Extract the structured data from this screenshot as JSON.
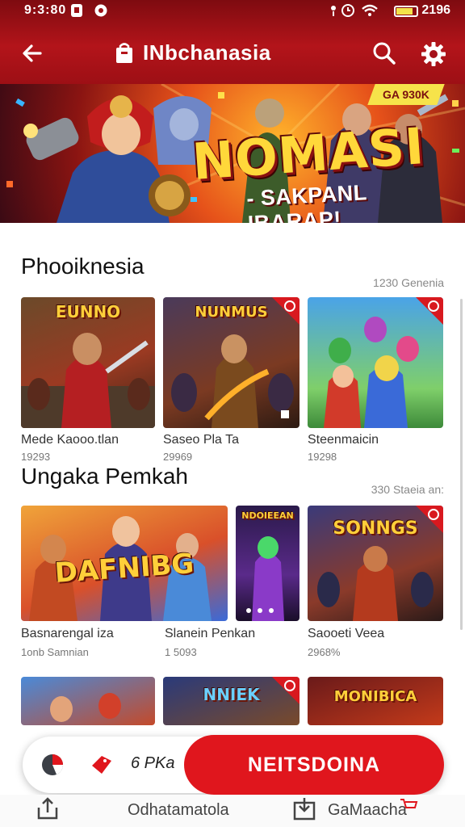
{
  "status_bar": {
    "time": "9:3:80",
    "battery_text": "2196"
  },
  "header": {
    "app_title": "INbchanasia"
  },
  "banner": {
    "corner_text": "GA 930K",
    "title": "NOMASI",
    "subtitle": "- SAKPANL IBARAP!"
  },
  "sections": [
    {
      "title": "Phooiknesia",
      "meta": "1230 Genenia",
      "cards": [
        {
          "thumb_text": "EUNNO",
          "title": "Mede Kaooo.tlan",
          "sub": "19293"
        },
        {
          "thumb_text": "NUNMUS",
          "title": "Saseo Pla Ta",
          "sub": "29969"
        },
        {
          "thumb_text": "",
          "title": "Steenmaicin",
          "sub": "19298"
        }
      ]
    },
    {
      "title": "Ungaka Pemkah",
      "meta": "330 Staeia an:",
      "cards": [
        {
          "thumb_text": "DAFNIBG",
          "title": "Basnarengal iza",
          "sub": "1onb Samnian"
        },
        {
          "thumb_text": "NDOIEEAN",
          "title": "Slanein Penkan",
          "sub": "1 5093"
        },
        {
          "thumb_text": "SONNGS",
          "title": "Saooeti Veea",
          "sub": "2968%"
        }
      ]
    },
    {
      "title": "",
      "meta": "",
      "cards": [
        {
          "thumb_text": "",
          "title": "",
          "sub": ""
        },
        {
          "thumb_text": "NNIEK",
          "title": "",
          "sub": ""
        },
        {
          "thumb_text": "MONIBICA",
          "title": "",
          "sub": ""
        }
      ]
    }
  ],
  "action_bar": {
    "price": "6 PKa",
    "primary_label": "NEITSDOINA"
  },
  "bottom_nav": [
    {
      "icon": "share-icon",
      "label": "Odhatamatola"
    },
    {
      "icon": "download-box-icon",
      "label": "GaMaacha"
    }
  ],
  "colors": {
    "brand_red": "#e0161d",
    "header_dark": "#8a0e13",
    "accent_yellow": "#f6e34a"
  }
}
